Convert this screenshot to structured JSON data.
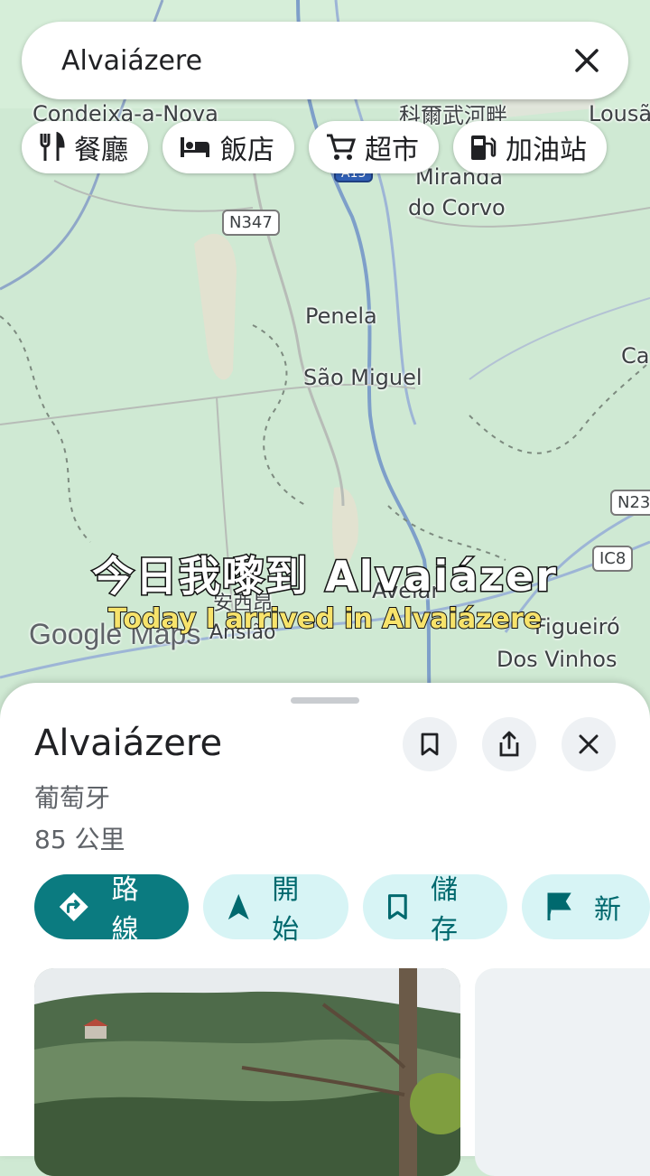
{
  "search": {
    "query": "Alvaiázere"
  },
  "chips": [
    {
      "label": "餐廳",
      "icon": "restaurant-icon"
    },
    {
      "label": "飯店",
      "icon": "hotel-icon"
    },
    {
      "label": "超市",
      "icon": "cart-icon"
    },
    {
      "label": "加油站",
      "icon": "gas-station-icon"
    }
  ],
  "map": {
    "places": [
      "Condeixa-a-Nova",
      "科爾武河畔",
      "Miranda",
      "do Corvo",
      "Penela",
      "São Miguel",
      "Avelar",
      "安西昂",
      "Ansião",
      "Figueiró",
      "Dos Vinhos",
      "Lousã",
      "Ca"
    ],
    "roads": [
      "N347",
      "A13",
      "IC8",
      "N23"
    ],
    "attribution": "Google Maps"
  },
  "subtitles": {
    "line1": "今日我嚟到 Alvaiázer",
    "line2": "Today I arrived in Alvaiázere"
  },
  "sheet": {
    "title": "Alvaiázere",
    "country": "葡萄牙",
    "distance": "85 公里",
    "actions": [
      {
        "label": "路線",
        "icon": "directions-icon"
      },
      {
        "label": "開始",
        "icon": "navigation-arrow-icon"
      },
      {
        "label": "儲存",
        "icon": "bookmark-icon"
      },
      {
        "label": "新",
        "icon": "flag-icon"
      }
    ]
  },
  "colors": {
    "accent": "#0b7b80",
    "chipBg": "#d7f4f5",
    "map": "#cfe9d3"
  }
}
